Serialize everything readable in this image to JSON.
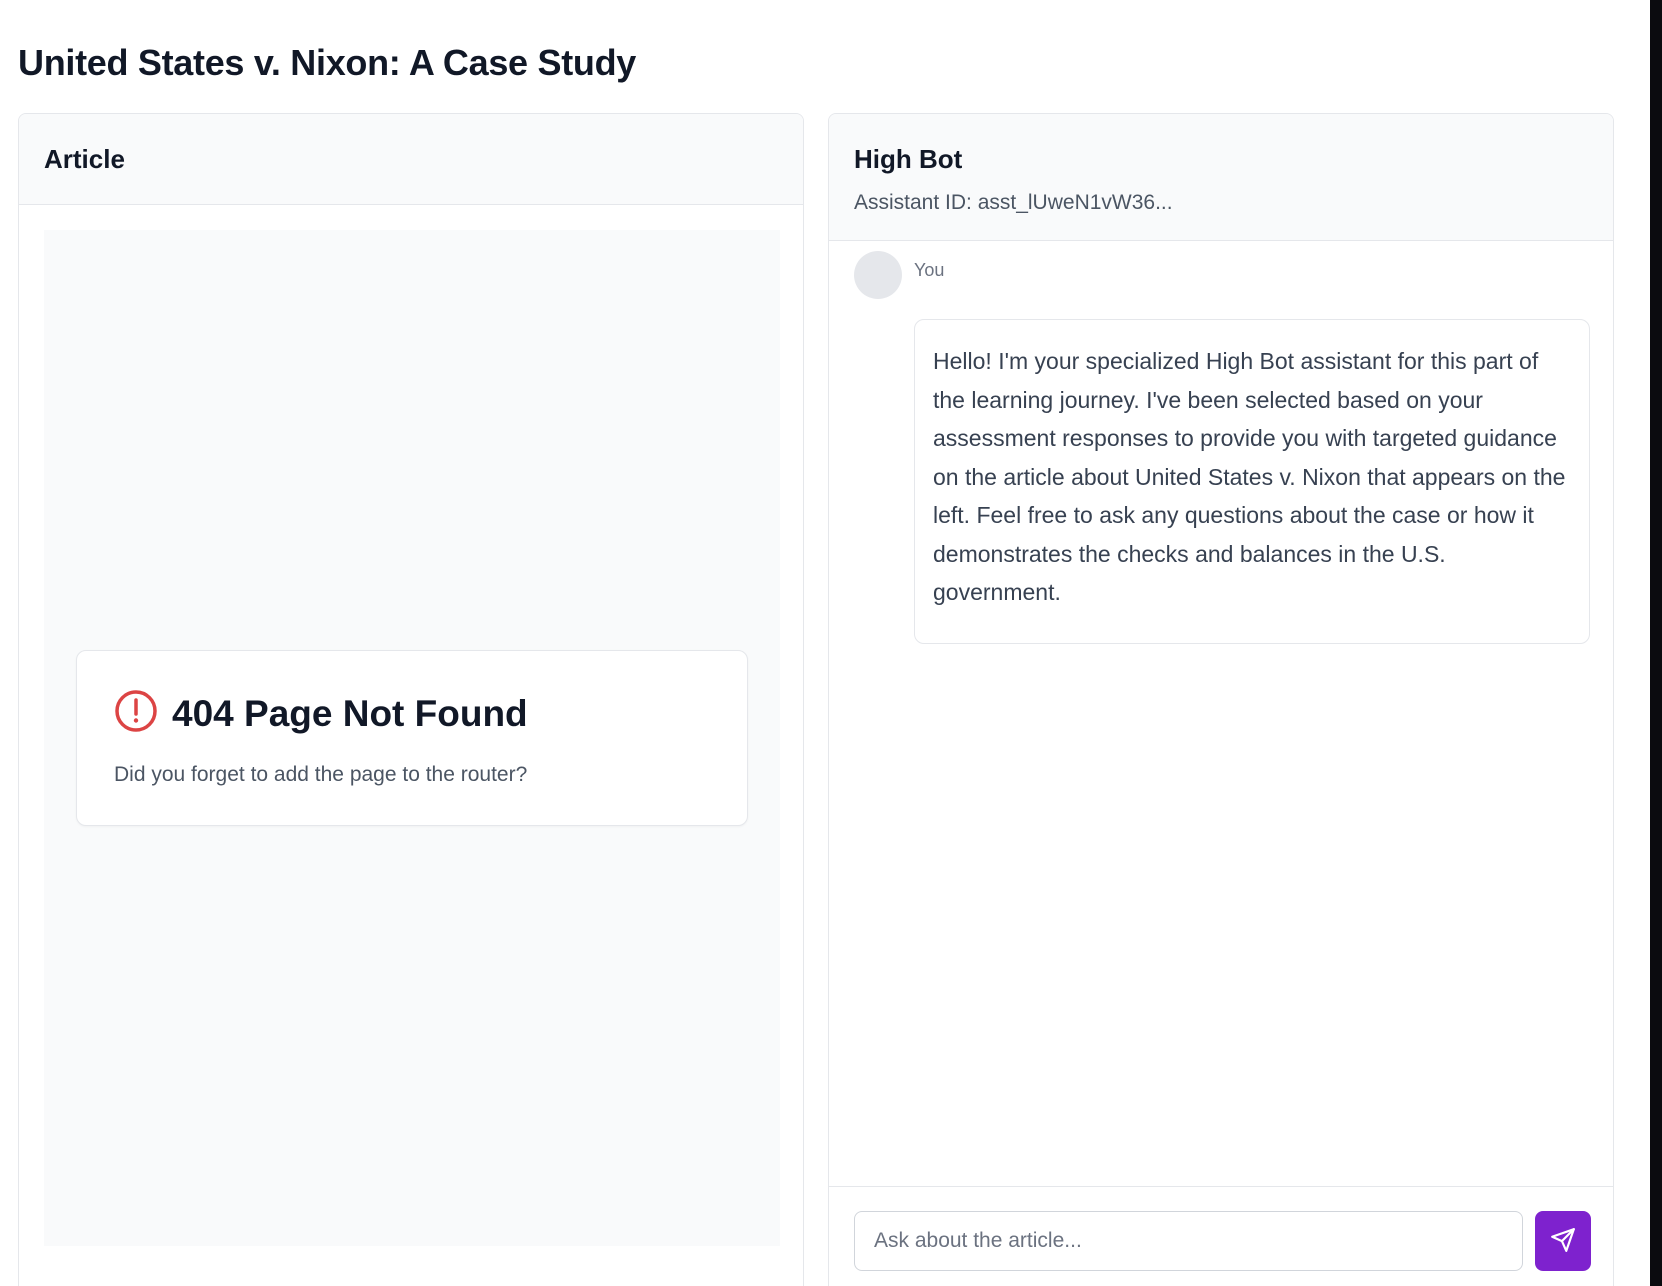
{
  "page": {
    "title": "United States v. Nixon: A Case Study"
  },
  "article_panel": {
    "title": "Article",
    "error": {
      "icon": "alert-circle-icon",
      "title": "404 Page Not Found",
      "message": "Did you forget to add the page to the router?"
    }
  },
  "chat_panel": {
    "title": "High Bot",
    "assistant_id": "Assistant ID: asst_lUweN1vW36...",
    "messages": [
      {
        "sender": "You",
        "text": "Hello! I'm your specialized High Bot assistant for this part of the learning journey. I've been selected based on your assessment responses to provide you with targeted guidance on the article about United States v. Nixon that appears on the left. Feel free to ask any questions about the case or how it demonstrates the checks and balances in the U.S. government."
      }
    ],
    "input": {
      "placeholder": "Ask about the article...",
      "value": ""
    },
    "send_button": {
      "icon": "send-icon"
    }
  },
  "colors": {
    "accent": "#7e22ce",
    "error": "#dc4444",
    "panel_header_bg": "#f9fafb",
    "border": "#e5e7eb"
  }
}
